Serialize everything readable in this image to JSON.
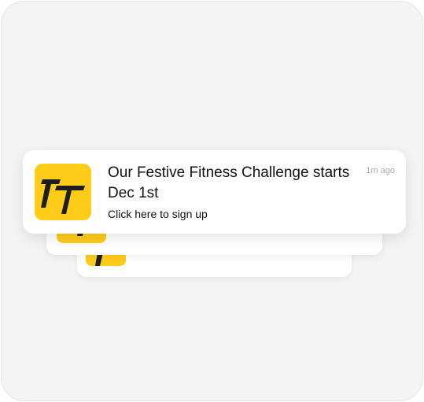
{
  "notification": {
    "title": "Our Festive Fitness Challenge starts Dec 1st",
    "subtitle": "Click here to sign up",
    "time": "1m ago",
    "icon": "brand-logo-icon"
  },
  "colors": {
    "brand_yellow": "#ffcc1a",
    "logo_mark": "#1e1e1e",
    "background": "#f4f4f4",
    "card": "#ffffff"
  }
}
